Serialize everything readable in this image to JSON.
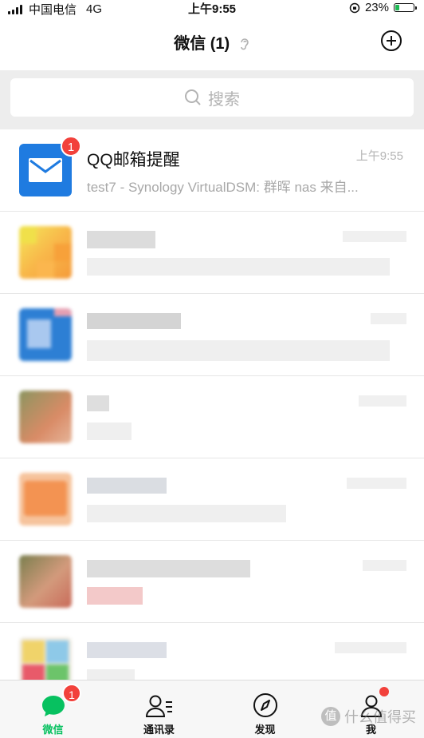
{
  "status_bar": {
    "carrier": "中国电信",
    "network": "4G",
    "time": "上午9:55",
    "battery_percent": "23%",
    "battery_level": 0.23,
    "battery_color": "#1db954"
  },
  "header": {
    "title": "微信 (1)",
    "ear_icon": "ear-icon",
    "add_icon": "plus-circle-icon"
  },
  "search": {
    "placeholder": "搜索",
    "icon": "search-icon"
  },
  "chats": [
    {
      "name": "QQ邮箱提醒",
      "time": "上午9:55",
      "preview": "test7 - Synology VirtualDSM: 群晖 nas 来自...",
      "badge": "1",
      "avatar_icon": "mail-icon",
      "avatar_color": "#1f7be0"
    }
  ],
  "tabbar": {
    "tabs": [
      {
        "label": "微信",
        "icon": "chat-bubble-icon",
        "badge": "1",
        "active": true
      },
      {
        "label": "通讯录",
        "icon": "contacts-icon"
      },
      {
        "label": "发现",
        "icon": "compass-icon"
      },
      {
        "label": "我",
        "icon": "person-icon",
        "dot": true
      }
    ],
    "active_color": "#07c160",
    "badge_color": "#f2413b"
  },
  "watermark": {
    "text": "什么值得买",
    "icon_text": "值"
  }
}
